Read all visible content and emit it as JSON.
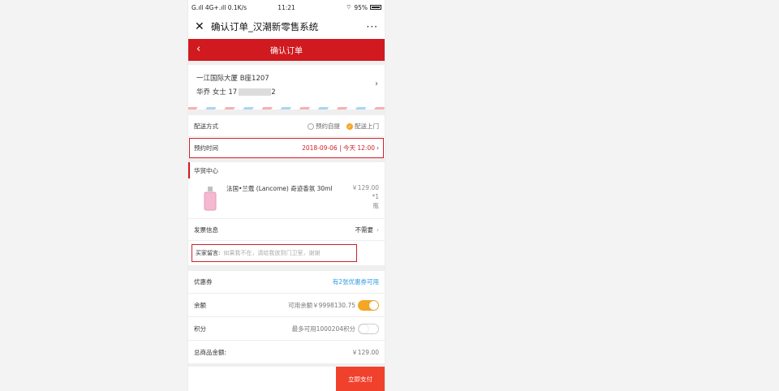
{
  "status_bar": {
    "left": "G.ıll 4G+.ıll 0.1K/s",
    "time": "11:21",
    "battery": "95%"
  },
  "title_bar": {
    "close_icon": "close-icon",
    "title": "确认订单_汉潮新零售系统",
    "more": "···"
  },
  "header": {
    "title": "确认订单",
    "back_icon": "chevron-left-icon"
  },
  "address": {
    "line1": "一江国际大厦    B座1207",
    "name": "华乔 女士 17",
    "phone_tail": "2"
  },
  "delivery": {
    "label": "配送方式",
    "option_pickup": "预约自提",
    "option_delivery": "配送上门",
    "selected": "配送上门"
  },
  "appointment": {
    "label": "预约时间",
    "value": "2018-09-06 | 今天 12:00"
  },
  "store": {
    "name": "华贸中心"
  },
  "product": {
    "name": "法国•兰蔻 (Lancome) 奇迹香氛 30ml",
    "price": "￥129.00",
    "qty": "*1",
    "unit": "瓶"
  },
  "invoice": {
    "label": "发票信息",
    "value": "不需要"
  },
  "message": {
    "label": "买家留言:",
    "placeholder": "如果我不在，请给我放到门卫室，谢谢"
  },
  "coupon": {
    "label": "优惠券",
    "value": "有2张优惠券可用"
  },
  "balance": {
    "label": "余额",
    "value": "可用余额￥9998130.75",
    "enabled": true
  },
  "points": {
    "label": "积分",
    "value": "最多可用1000204积分",
    "enabled": false
  },
  "total": {
    "label": "总商品金额:",
    "value": "￥129.00"
  },
  "footer": {
    "pay_button": "立即支付"
  },
  "colors": {
    "brand_red": "#d01a1f",
    "accent_orange": "#f5a623",
    "link_blue": "#2a9be0",
    "pay_red": "#f0412d"
  }
}
